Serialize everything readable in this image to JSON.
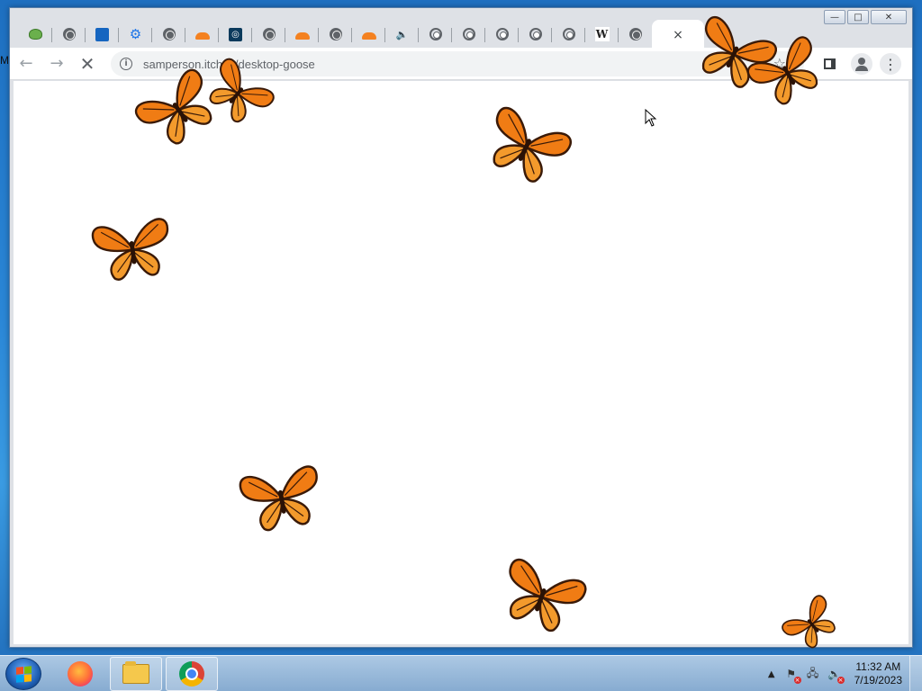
{
  "desktop": {
    "edge_text": "M"
  },
  "browser": {
    "tabs": [
      {
        "icon": "frog-icon"
      },
      {
        "icon": "globe-icon"
      },
      {
        "icon": "chart-icon"
      },
      {
        "icon": "gear-icon"
      },
      {
        "icon": "globe-icon"
      },
      {
        "icon": "cloud-icon"
      },
      {
        "icon": "quiz-icon"
      },
      {
        "icon": "globe-icon"
      },
      {
        "icon": "cloud-icon"
      },
      {
        "icon": "globe-icon"
      },
      {
        "icon": "cloud-icon"
      },
      {
        "icon": "speaker-icon"
      },
      {
        "icon": "chrome-icon"
      },
      {
        "icon": "chrome-icon"
      },
      {
        "icon": "chrome-icon"
      },
      {
        "icon": "chrome-icon"
      },
      {
        "icon": "chrome-icon"
      },
      {
        "icon": "chrome-icon"
      },
      {
        "icon": "wikipedia-icon"
      },
      {
        "icon": "globe-icon"
      }
    ],
    "active_tab_close": "×",
    "new_tab_label": "+",
    "window_buttons": {
      "minimize": "—",
      "maximize": "□",
      "close": "✕"
    },
    "toolbar": {
      "back": "←",
      "forward": "→",
      "reload": "✕",
      "info": "i",
      "url": "samperson.itch.io/desktop-goose",
      "star": "☆",
      "menu": "⋮"
    }
  },
  "taskbar": {
    "items": [
      {
        "name": "firefox"
      },
      {
        "name": "file-explorer"
      },
      {
        "name": "chrome"
      }
    ],
    "tray_arrow": "▲",
    "clock_time": "11:32 AM",
    "clock_date": "7/19/2023"
  },
  "colors": {
    "butterfly_orange": "#f07c14",
    "butterfly_dark": "#3a1a08",
    "accent_blue": "#1a73e8"
  }
}
